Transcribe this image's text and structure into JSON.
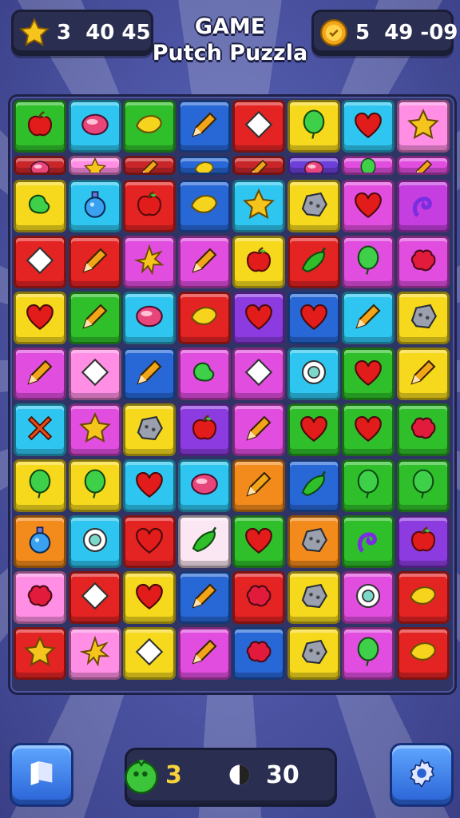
{
  "header": {
    "stars_value": "3  40 45",
    "title_line1": "GAME",
    "title_line2": "Putch Puzzla",
    "coins_value": "5  49 -09"
  },
  "board": {
    "rows": [
      {
        "type": "full",
        "tiles": [
          {
            "bg": "#2fbf2a",
            "icon": "apple"
          },
          {
            "bg": "#2ec6f0",
            "icon": "gem"
          },
          {
            "bg": "#2fbf2a",
            "icon": "lemon"
          },
          {
            "bg": "#2767d6",
            "icon": "pencil"
          },
          {
            "bg": "#e42323",
            "icon": "diamond"
          },
          {
            "bg": "#f6d91d",
            "icon": "balloon"
          },
          {
            "bg": "#2ec6f0",
            "icon": "heart"
          },
          {
            "bg": "#ff8ee4",
            "icon": "star"
          }
        ]
      },
      {
        "type": "strip",
        "tiles": [
          {
            "bg": "#c9262a",
            "icon": "gem"
          },
          {
            "bg": "#ff8ee4",
            "icon": "star"
          },
          {
            "bg": "#c9262a",
            "icon": "pencil"
          },
          {
            "bg": "#2767d6",
            "icon": "lemon"
          },
          {
            "bg": "#c9262a",
            "icon": "pencil"
          },
          {
            "bg": "#6b3fd8",
            "icon": "gem"
          },
          {
            "bg": "#e14ddf",
            "icon": "balloon"
          },
          {
            "bg": "#e14ddf",
            "icon": "pencil"
          }
        ]
      },
      {
        "type": "full",
        "tiles": [
          {
            "bg": "#f6d91d",
            "icon": "bean"
          },
          {
            "bg": "#2ec6f0",
            "icon": "potion"
          },
          {
            "bg": "#e42323",
            "icon": "apple"
          },
          {
            "bg": "#2767d6",
            "icon": "lemon"
          },
          {
            "bg": "#2ec6f0",
            "icon": "star"
          },
          {
            "bg": "#f6d91d",
            "icon": "rock"
          },
          {
            "bg": "#e14ddf",
            "icon": "heart"
          },
          {
            "bg": "#c53ee0",
            "icon": "swirl"
          }
        ]
      },
      {
        "type": "full",
        "tiles": [
          {
            "bg": "#e42323",
            "icon": "diamond"
          },
          {
            "bg": "#e42323",
            "icon": "pencil"
          },
          {
            "bg": "#e14ddf",
            "icon": "burst"
          },
          {
            "bg": "#e14ddf",
            "icon": "pencil"
          },
          {
            "bg": "#f6d91d",
            "icon": "apple"
          },
          {
            "bg": "#e42323",
            "icon": "pepper"
          },
          {
            "bg": "#e14ddf",
            "icon": "balloon"
          },
          {
            "bg": "#e14ddf",
            "icon": "blob"
          }
        ]
      },
      {
        "type": "full",
        "tiles": [
          {
            "bg": "#f6d91d",
            "icon": "heart"
          },
          {
            "bg": "#2fbf2a",
            "icon": "pencil"
          },
          {
            "bg": "#2ec6f0",
            "icon": "gem"
          },
          {
            "bg": "#e42323",
            "icon": "lemon"
          },
          {
            "bg": "#8c3be0",
            "icon": "heart"
          },
          {
            "bg": "#2767d6",
            "icon": "heart"
          },
          {
            "bg": "#2ec6f0",
            "icon": "pencil"
          },
          {
            "bg": "#f6d91d",
            "icon": "rock"
          }
        ]
      },
      {
        "type": "full",
        "tiles": [
          {
            "bg": "#e14ddf",
            "icon": "pencil"
          },
          {
            "bg": "#ff8ee4",
            "icon": "diamond"
          },
          {
            "bg": "#2767d6",
            "icon": "pencil"
          },
          {
            "bg": "#e14ddf",
            "icon": "bean"
          },
          {
            "bg": "#e14ddf",
            "icon": "diamond"
          },
          {
            "bg": "#2ec6f0",
            "icon": "ring"
          },
          {
            "bg": "#2fbf2a",
            "icon": "heart"
          },
          {
            "bg": "#f6d91d",
            "icon": "pencil"
          }
        ]
      },
      {
        "type": "full",
        "tiles": [
          {
            "bg": "#2ec6f0",
            "icon": "cross"
          },
          {
            "bg": "#e14ddf",
            "icon": "star"
          },
          {
            "bg": "#f6d91d",
            "icon": "rock"
          },
          {
            "bg": "#8c3be0",
            "icon": "apple"
          },
          {
            "bg": "#e14ddf",
            "icon": "pencil"
          },
          {
            "bg": "#2fbf2a",
            "icon": "heart"
          },
          {
            "bg": "#2fbf2a",
            "icon": "heart"
          },
          {
            "bg": "#2fbf2a",
            "icon": "blob"
          }
        ]
      },
      {
        "type": "full",
        "tiles": [
          {
            "bg": "#f6d91d",
            "icon": "balloon"
          },
          {
            "bg": "#f6d91d",
            "icon": "balloon"
          },
          {
            "bg": "#2ec6f0",
            "icon": "heart"
          },
          {
            "bg": "#2ec6f0",
            "icon": "gem"
          },
          {
            "bg": "#f28b1b",
            "icon": "pencil"
          },
          {
            "bg": "#2767d6",
            "icon": "pepper"
          },
          {
            "bg": "#2fbf2a",
            "icon": "balloon"
          },
          {
            "bg": "#2fbf2a",
            "icon": "balloon"
          }
        ]
      },
      {
        "type": "full",
        "tiles": [
          {
            "bg": "#f28b1b",
            "icon": "potion"
          },
          {
            "bg": "#2ec6f0",
            "icon": "ring"
          },
          {
            "bg": "#e42323",
            "icon": "heart"
          },
          {
            "bg": "#fbe6f3",
            "icon": "pepper"
          },
          {
            "bg": "#2fbf2a",
            "icon": "heart"
          },
          {
            "bg": "#f28b1b",
            "icon": "rock"
          },
          {
            "bg": "#2fbf2a",
            "icon": "swirl"
          },
          {
            "bg": "#8c3be0",
            "icon": "apple"
          }
        ]
      },
      {
        "type": "full",
        "tiles": [
          {
            "bg": "#ff8ee4",
            "icon": "blob"
          },
          {
            "bg": "#e42323",
            "icon": "diamond"
          },
          {
            "bg": "#f6d91d",
            "icon": "heart"
          },
          {
            "bg": "#2767d6",
            "icon": "pencil"
          },
          {
            "bg": "#e42323",
            "icon": "blob"
          },
          {
            "bg": "#f6d91d",
            "icon": "rock"
          },
          {
            "bg": "#e14ddf",
            "icon": "ring"
          },
          {
            "bg": "#e42323",
            "icon": "lemon"
          }
        ]
      },
      {
        "type": "full",
        "tiles": [
          {
            "bg": "#e42323",
            "icon": "star"
          },
          {
            "bg": "#ff8ee4",
            "icon": "burst"
          },
          {
            "bg": "#f6d91d",
            "icon": "diamond"
          },
          {
            "bg": "#e14ddf",
            "icon": "pencil"
          },
          {
            "bg": "#2767d6",
            "icon": "blob"
          },
          {
            "bg": "#f6d91d",
            "icon": "rock"
          },
          {
            "bg": "#e14ddf",
            "icon": "balloon"
          },
          {
            "bg": "#e42323",
            "icon": "lemon"
          }
        ]
      }
    ]
  },
  "footer": {
    "moves_value": "3",
    "time_value": "30"
  }
}
